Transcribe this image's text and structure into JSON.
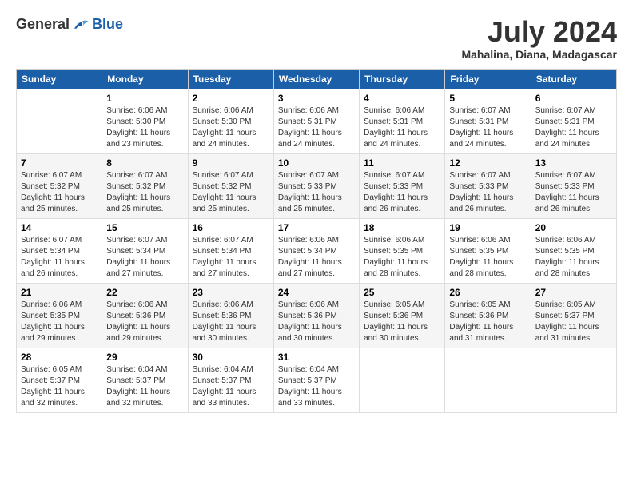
{
  "logo": {
    "general": "General",
    "blue": "Blue"
  },
  "title": {
    "month_year": "July 2024",
    "location": "Mahalina, Diana, Madagascar"
  },
  "days_of_week": [
    "Sunday",
    "Monday",
    "Tuesday",
    "Wednesday",
    "Thursday",
    "Friday",
    "Saturday"
  ],
  "weeks": [
    [
      {
        "day": "",
        "info": ""
      },
      {
        "day": "1",
        "info": "Sunrise: 6:06 AM\nSunset: 5:30 PM\nDaylight: 11 hours\nand 23 minutes."
      },
      {
        "day": "2",
        "info": "Sunrise: 6:06 AM\nSunset: 5:30 PM\nDaylight: 11 hours\nand 24 minutes."
      },
      {
        "day": "3",
        "info": "Sunrise: 6:06 AM\nSunset: 5:31 PM\nDaylight: 11 hours\nand 24 minutes."
      },
      {
        "day": "4",
        "info": "Sunrise: 6:06 AM\nSunset: 5:31 PM\nDaylight: 11 hours\nand 24 minutes."
      },
      {
        "day": "5",
        "info": "Sunrise: 6:07 AM\nSunset: 5:31 PM\nDaylight: 11 hours\nand 24 minutes."
      },
      {
        "day": "6",
        "info": "Sunrise: 6:07 AM\nSunset: 5:31 PM\nDaylight: 11 hours\nand 24 minutes."
      }
    ],
    [
      {
        "day": "7",
        "info": "Sunrise: 6:07 AM\nSunset: 5:32 PM\nDaylight: 11 hours\nand 25 minutes."
      },
      {
        "day": "8",
        "info": "Sunrise: 6:07 AM\nSunset: 5:32 PM\nDaylight: 11 hours\nand 25 minutes."
      },
      {
        "day": "9",
        "info": "Sunrise: 6:07 AM\nSunset: 5:32 PM\nDaylight: 11 hours\nand 25 minutes."
      },
      {
        "day": "10",
        "info": "Sunrise: 6:07 AM\nSunset: 5:33 PM\nDaylight: 11 hours\nand 25 minutes."
      },
      {
        "day": "11",
        "info": "Sunrise: 6:07 AM\nSunset: 5:33 PM\nDaylight: 11 hours\nand 26 minutes."
      },
      {
        "day": "12",
        "info": "Sunrise: 6:07 AM\nSunset: 5:33 PM\nDaylight: 11 hours\nand 26 minutes."
      },
      {
        "day": "13",
        "info": "Sunrise: 6:07 AM\nSunset: 5:33 PM\nDaylight: 11 hours\nand 26 minutes."
      }
    ],
    [
      {
        "day": "14",
        "info": "Sunrise: 6:07 AM\nSunset: 5:34 PM\nDaylight: 11 hours\nand 26 minutes."
      },
      {
        "day": "15",
        "info": "Sunrise: 6:07 AM\nSunset: 5:34 PM\nDaylight: 11 hours\nand 27 minutes."
      },
      {
        "day": "16",
        "info": "Sunrise: 6:07 AM\nSunset: 5:34 PM\nDaylight: 11 hours\nand 27 minutes."
      },
      {
        "day": "17",
        "info": "Sunrise: 6:06 AM\nSunset: 5:34 PM\nDaylight: 11 hours\nand 27 minutes."
      },
      {
        "day": "18",
        "info": "Sunrise: 6:06 AM\nSunset: 5:35 PM\nDaylight: 11 hours\nand 28 minutes."
      },
      {
        "day": "19",
        "info": "Sunrise: 6:06 AM\nSunset: 5:35 PM\nDaylight: 11 hours\nand 28 minutes."
      },
      {
        "day": "20",
        "info": "Sunrise: 6:06 AM\nSunset: 5:35 PM\nDaylight: 11 hours\nand 28 minutes."
      }
    ],
    [
      {
        "day": "21",
        "info": "Sunrise: 6:06 AM\nSunset: 5:35 PM\nDaylight: 11 hours\nand 29 minutes."
      },
      {
        "day": "22",
        "info": "Sunrise: 6:06 AM\nSunset: 5:36 PM\nDaylight: 11 hours\nand 29 minutes."
      },
      {
        "day": "23",
        "info": "Sunrise: 6:06 AM\nSunset: 5:36 PM\nDaylight: 11 hours\nand 30 minutes."
      },
      {
        "day": "24",
        "info": "Sunrise: 6:06 AM\nSunset: 5:36 PM\nDaylight: 11 hours\nand 30 minutes."
      },
      {
        "day": "25",
        "info": "Sunrise: 6:05 AM\nSunset: 5:36 PM\nDaylight: 11 hours\nand 30 minutes."
      },
      {
        "day": "26",
        "info": "Sunrise: 6:05 AM\nSunset: 5:36 PM\nDaylight: 11 hours\nand 31 minutes."
      },
      {
        "day": "27",
        "info": "Sunrise: 6:05 AM\nSunset: 5:37 PM\nDaylight: 11 hours\nand 31 minutes."
      }
    ],
    [
      {
        "day": "28",
        "info": "Sunrise: 6:05 AM\nSunset: 5:37 PM\nDaylight: 11 hours\nand 32 minutes."
      },
      {
        "day": "29",
        "info": "Sunrise: 6:04 AM\nSunset: 5:37 PM\nDaylight: 11 hours\nand 32 minutes."
      },
      {
        "day": "30",
        "info": "Sunrise: 6:04 AM\nSunset: 5:37 PM\nDaylight: 11 hours\nand 33 minutes."
      },
      {
        "day": "31",
        "info": "Sunrise: 6:04 AM\nSunset: 5:37 PM\nDaylight: 11 hours\nand 33 minutes."
      },
      {
        "day": "",
        "info": ""
      },
      {
        "day": "",
        "info": ""
      },
      {
        "day": "",
        "info": ""
      }
    ]
  ]
}
